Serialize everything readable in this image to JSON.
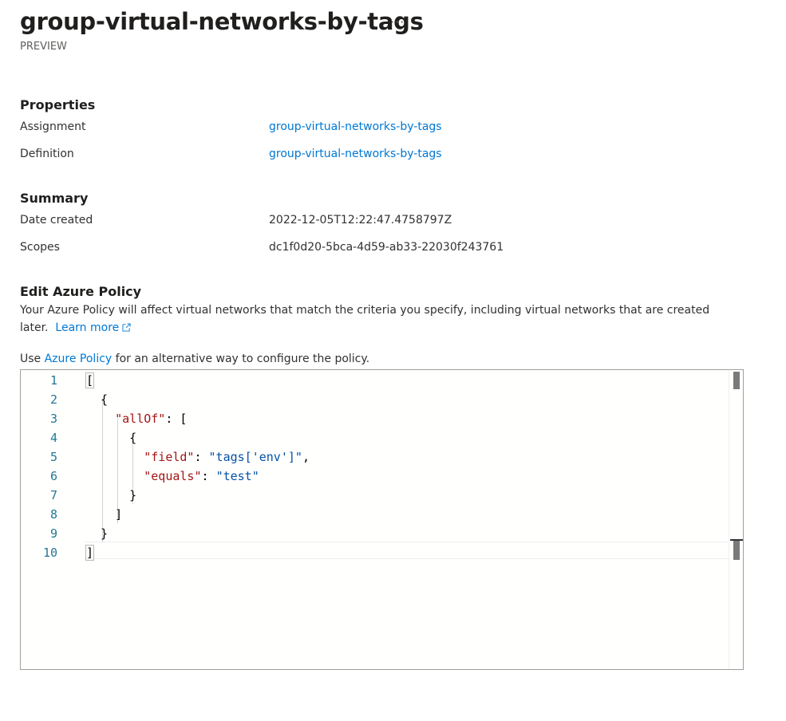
{
  "header": {
    "title": "group-virtual-networks-by-tags",
    "more_label": "···",
    "subtitle": "PREVIEW"
  },
  "properties": {
    "heading": "Properties",
    "rows": [
      {
        "label": "Assignment",
        "value": "group-virtual-networks-by-tags"
      },
      {
        "label": "Definition",
        "value": "group-virtual-networks-by-tags"
      }
    ]
  },
  "summary": {
    "heading": "Summary",
    "rows": [
      {
        "label": "Date created",
        "value": "2022-12-05T12:22:47.4758797Z"
      },
      {
        "label": "Scopes",
        "value": "dc1f0d20-5bca-4d59-ab33-22030f243761"
      }
    ]
  },
  "edit_policy": {
    "heading": "Edit Azure Policy",
    "description": "Your Azure Policy will affect virtual networks that match the criteria you specify, including virtual networks that are created later.",
    "learn_more": "Learn more",
    "use_prefix": "Use ",
    "use_link": "Azure Policy",
    "use_suffix": " for an alternative way to configure the policy."
  },
  "editor": {
    "line_numbers": [
      "1",
      "2",
      "3",
      "4",
      "5",
      "6",
      "7",
      "8",
      "9",
      "10"
    ],
    "lines": [
      [
        {
          "t": "p",
          "v": "["
        }
      ],
      [
        {
          "t": "p",
          "v": "  {"
        }
      ],
      [
        {
          "t": "p",
          "v": "    "
        },
        {
          "t": "key",
          "v": "\"allOf\""
        },
        {
          "t": "p",
          "v": ": ["
        }
      ],
      [
        {
          "t": "p",
          "v": "      {"
        }
      ],
      [
        {
          "t": "p",
          "v": "        "
        },
        {
          "t": "key",
          "v": "\"field\""
        },
        {
          "t": "p",
          "v": ": "
        },
        {
          "t": "str",
          "v": "\"tags['env']\""
        },
        {
          "t": "p",
          "v": ","
        }
      ],
      [
        {
          "t": "p",
          "v": "        "
        },
        {
          "t": "key",
          "v": "\"equals\""
        },
        {
          "t": "p",
          "v": ": "
        },
        {
          "t": "str",
          "v": "\"test\""
        }
      ],
      [
        {
          "t": "p",
          "v": "      }"
        }
      ],
      [
        {
          "t": "p",
          "v": "    ]"
        }
      ],
      [
        {
          "t": "p",
          "v": "  }"
        }
      ],
      [
        {
          "t": "p",
          "v": "]"
        }
      ]
    ]
  },
  "colors": {
    "link": "#0078d4",
    "json_key": "#a31515",
    "json_string": "#0451a5",
    "line_number": "#237893"
  }
}
